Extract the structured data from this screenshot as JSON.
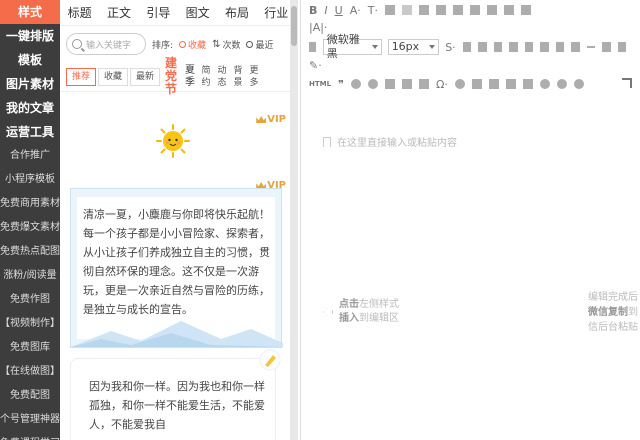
{
  "sidebar": {
    "items": [
      {
        "label": "样式",
        "type": "active"
      },
      {
        "label": "一键排版",
        "type": "main"
      },
      {
        "label": "模板",
        "type": "main"
      },
      {
        "label": "图片素材",
        "type": "main"
      },
      {
        "label": "我的文章",
        "type": "main"
      },
      {
        "label": "运营工具",
        "type": "main"
      },
      {
        "label": "合作推广",
        "type": "sub"
      },
      {
        "label": "小程序模板",
        "type": "sub"
      },
      {
        "label": "免费商用素材",
        "type": "sub"
      },
      {
        "label": "免费爆文素材",
        "type": "sub"
      },
      {
        "label": "免费热点配图",
        "type": "sub"
      },
      {
        "label": "涨粉/阅读量",
        "type": "sub"
      },
      {
        "label": "免费作图",
        "type": "sub"
      },
      {
        "label": "【视频制作】",
        "type": "sub"
      },
      {
        "label": "免费图库",
        "type": "sub"
      },
      {
        "label": "【在线做图】",
        "type": "sub"
      },
      {
        "label": "免费配图",
        "type": "sub"
      },
      {
        "label": "个号管理神器",
        "type": "sub"
      },
      {
        "label": "免费课程学习",
        "type": "sub"
      }
    ]
  },
  "tabs": [
    "标题",
    "正文",
    "引导",
    "图文",
    "布局",
    "行业"
  ],
  "search": {
    "placeholder": "输入关键字"
  },
  "sort": {
    "label": "排序:",
    "options": [
      {
        "label": "收藏",
        "active": true
      },
      {
        "label": "次数",
        "active": false
      },
      {
        "label": "最近",
        "active": false
      }
    ]
  },
  "filters": {
    "buttons": [
      {
        "label": "推荐",
        "active": true
      },
      {
        "label": "收藏",
        "active": false
      },
      {
        "label": "最新",
        "active": false
      }
    ],
    "big": "建党节",
    "medium": "夏季",
    "small": [
      "简约",
      "动态",
      "背景",
      "更多"
    ]
  },
  "cards": {
    "vip_label": "VIP",
    "card1_text": "清凉一夏，小麋鹿与你即将快乐起航！每一个孩子都是小小冒险家、探索者，从小让孩子们养成独立自主的习惯，贯彻自然环保的理念。这不仅是一次游玩，更是一次亲近自然与冒险的历练，是独立与成长的宣告。",
    "card2_text": "因为我和你一样。因为我也和你一样孤独，和你一样不能爱生活，不能爱人，不能爱我自"
  },
  "editor": {
    "font_family": "微软雅黑",
    "font_size": "16px",
    "html_label": "HTML",
    "placeholder": "在这里直接输入或粘贴内容",
    "hint_left": {
      "line1_bold": "点击",
      "line1_rest": "左侧样式",
      "line2_bold": "插入",
      "line2_rest": "到编辑区"
    },
    "hint_right": {
      "line1": "编辑完成后",
      "line2_bold": "微信复制",
      "line2_rest": "到",
      "line3": "信后台粘贴"
    }
  },
  "colors": {
    "accent": "#f56c4a",
    "vip": "#e8a33a",
    "sidebar_bg": "#3d3d3d"
  }
}
